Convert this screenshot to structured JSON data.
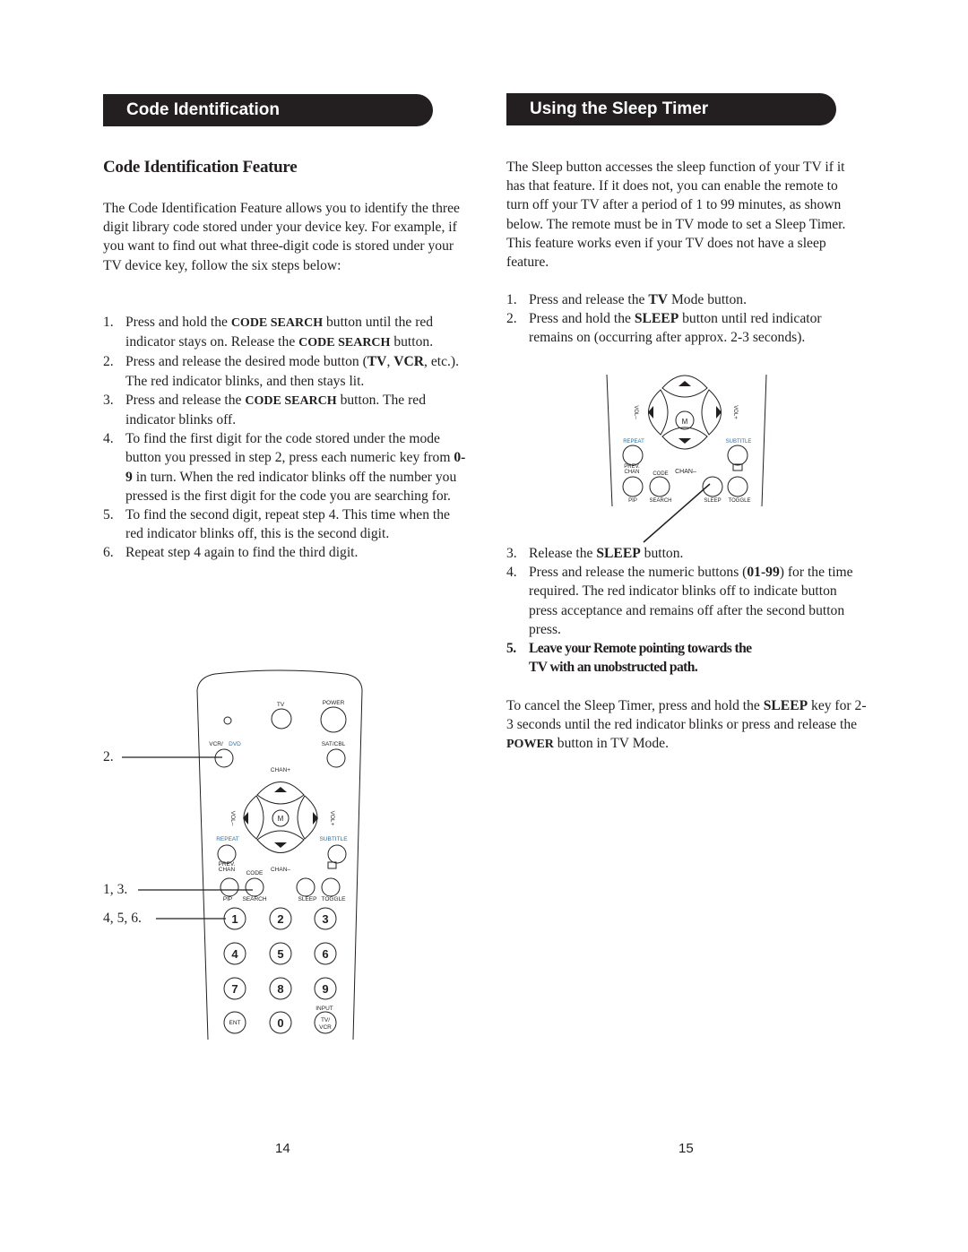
{
  "left_page": {
    "banner_title": "Code Identification",
    "subheading": "Code Identification Feature",
    "intro": "The Code Identification Feature allows you to identify the three digit library code stored under your device key. For example, if you want to find out what three-digit code is stored under your TV device key, follow the six steps below:",
    "steps": [
      {
        "num": "1.",
        "parts": [
          "Press and hold the ",
          "CODE SEARCH",
          " button until the red indicator stays on. Release the ",
          "CODE SEARCH",
          " button."
        ]
      },
      {
        "num": "2.",
        "parts": [
          "Press and release the desired mode button (",
          "TV",
          ", ",
          "VCR",
          ", etc.). The red indicator blinks, and then stays lit."
        ]
      },
      {
        "num": "3.",
        "parts": [
          "Press and release the ",
          "CODE SEARCH",
          " button. The red indicator blinks off."
        ]
      },
      {
        "num": "4.",
        "parts": [
          "To find the first digit for the code stored under the mode button you pressed in step 2, press each numeric key from ",
          "0-9",
          " in turn. When the red indicator blinks off the number you pressed is the first digit for the code you are searching for."
        ]
      },
      {
        "num": "5.",
        "text": "To find the second digit, repeat step 4. This time when the red indicator blinks off, this is the second digit."
      },
      {
        "num": "6.",
        "text": "Repeat step 4 again to find the third digit."
      }
    ],
    "callouts": {
      "c1": "2.",
      "c2": "1, 3.",
      "c3": "4, 5, 6."
    },
    "remote": {
      "tv": "TV",
      "power": "POWER",
      "vcr": "VCR/",
      "dvd": "DVD",
      "satcbl": "SAT/CBL",
      "chan_plus": "CHAN+",
      "chan_minus": "CHAN–",
      "vol_minus": "VOL–",
      "vol_plus": "VOL+",
      "menu": "M",
      "repeat": "REPEAT",
      "subtitle": "SUBTITLE",
      "prev": "PREV.",
      "chan": "CHAN",
      "code": "CODE",
      "cc": "CC",
      "pip": "PIP",
      "search": "SEARCH",
      "sleep": "SLEEP",
      "toggle": "TOGGLE",
      "digits": [
        "1",
        "2",
        "3",
        "4",
        "5",
        "6",
        "7",
        "8",
        "9"
      ],
      "input": "INPUT",
      "ent": "ENT",
      "zero": "0",
      "tv_slash": "TV/",
      "vcr2": "VCR"
    },
    "page_number": "14"
  },
  "right_page": {
    "banner_title": "Using the Sleep Timer",
    "intro": "The Sleep button accesses the sleep function of your TV if it has that feature. If it does not, you can enable the remote to turn off your TV after a period of 1 to 99 minutes, as shown below. The remote must be in TV mode to set a Sleep Timer. This feature works even if your TV does not have a sleep feature.",
    "steps_a": [
      {
        "num": "1.",
        "parts": [
          "Press and release the ",
          "TV",
          " Mode button."
        ]
      },
      {
        "num": "2.",
        "parts": [
          "Press and hold the ",
          "SLEEP",
          " button until red indicator remains on (occurring after approx. 2-3 seconds)."
        ]
      }
    ],
    "steps_b": [
      {
        "num": "3.",
        "parts": [
          "Release the ",
          "SLEEP",
          " button."
        ]
      },
      {
        "num": "4.",
        "parts": [
          "Press and release the numeric buttons (",
          "01-99",
          ") for the time required. The red indicator blinks off to indicate button press acceptance and remains off after the second button press."
        ]
      },
      {
        "num": "5.",
        "text": "Leave your Remote pointing towards the TV with an unobstructed path."
      }
    ],
    "cancel": {
      "parts": [
        "To cancel the Sleep Timer, press and hold the ",
        "SLEEP",
        " key for 2-3 seconds until the red indicator blinks or press and release the ",
        "POWER",
        " button in TV Mode."
      ]
    },
    "page_number": "15"
  },
  "colors": {
    "banner_bg": "#231f20",
    "banner_text": "#ffffff",
    "remote_blue": "#1b75bb",
    "ink": "#231f20"
  }
}
